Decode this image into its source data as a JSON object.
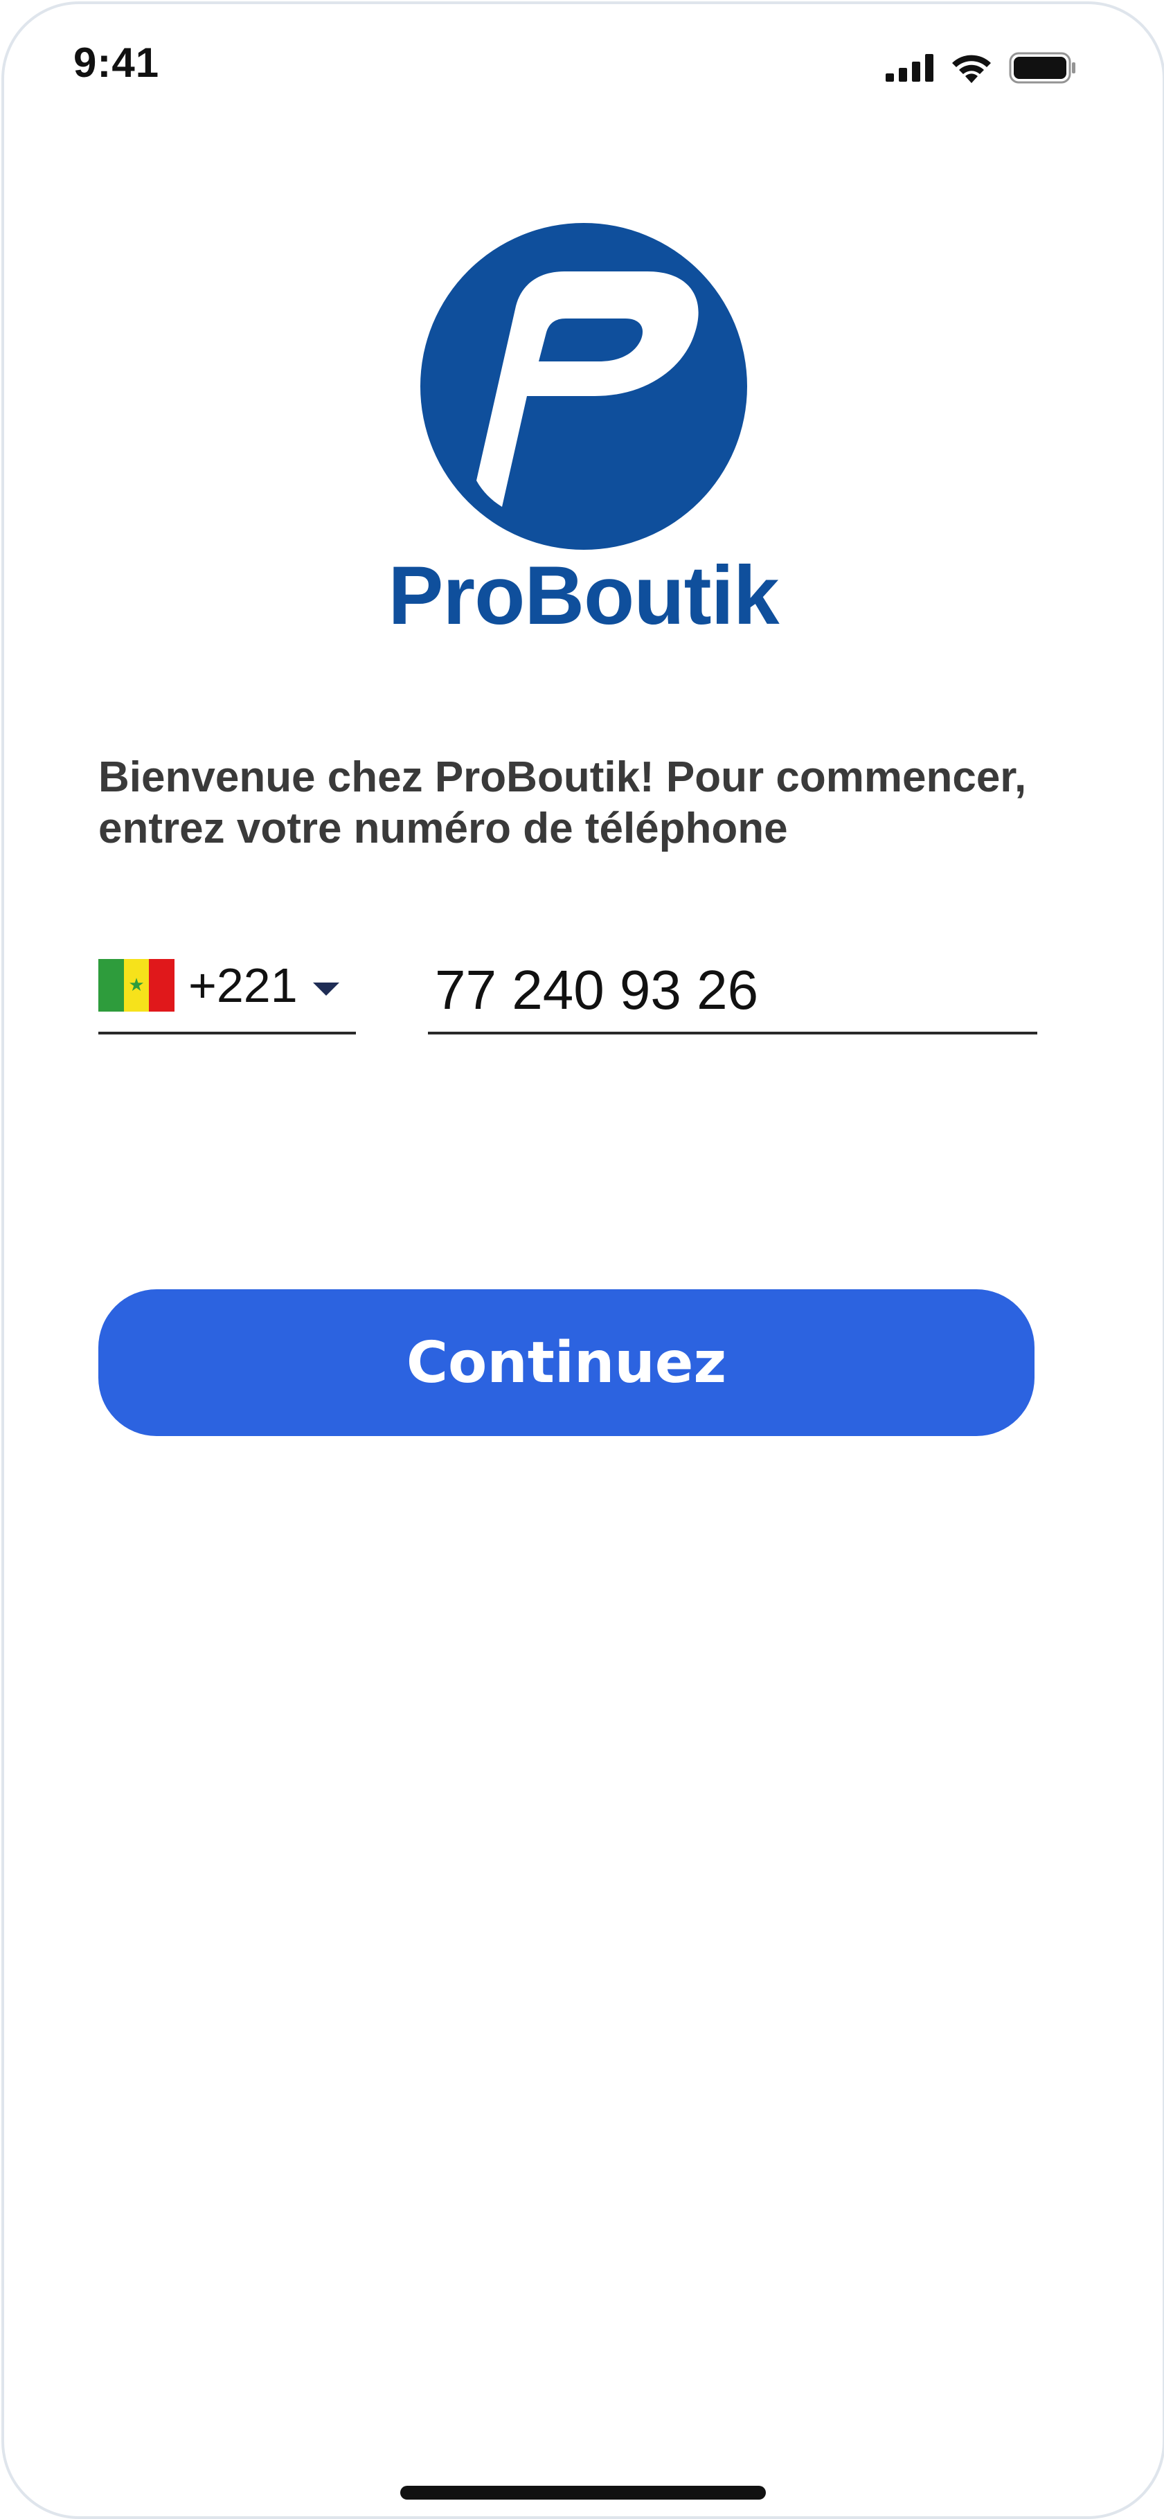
{
  "status_bar": {
    "time": "9:41",
    "icons": [
      "signal-icon",
      "wifi-icon",
      "battery-icon"
    ]
  },
  "brand": {
    "name": "ProBoutik",
    "color": "#0f4f9c"
  },
  "welcome": {
    "text": "Bienvenue chez ProBoutik! Pour commencer, entrez votre numéro de téléphone"
  },
  "phone": {
    "country_flag": "senegal-flag-icon",
    "dial_code": "+221",
    "number": "77 240 93 26"
  },
  "actions": {
    "continue_label": "Continuez",
    "continue_color": "#2c63e0"
  }
}
